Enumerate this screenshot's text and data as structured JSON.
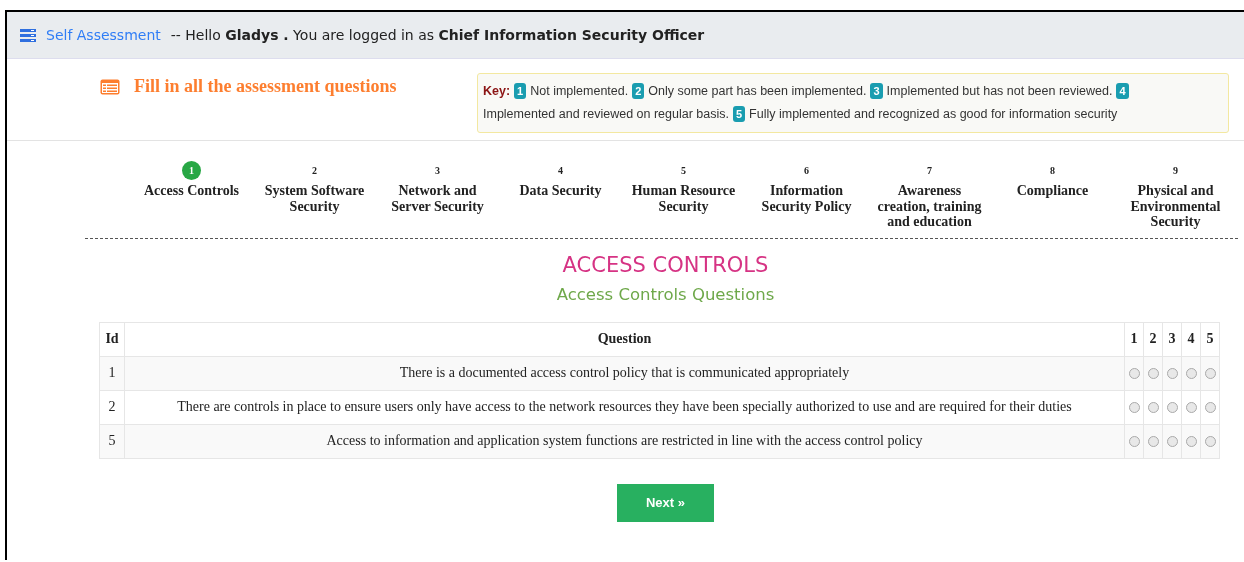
{
  "header": {
    "link": "Self Assessment",
    "greeting": "-- Hello **Gladys .** You are logged in as **Chief Information Security Officer**"
  },
  "intro": {
    "title": "Fill in all the assessment questions"
  },
  "key": {
    "label": "Key:",
    "items": [
      {
        "number": "1",
        "text": "Not implemented."
      },
      {
        "number": "2",
        "text": "Only some part has been implemented."
      },
      {
        "number": "3",
        "text": "Implemented but has not been reviewed."
      },
      {
        "number": "4",
        "text": "Implemented and reviewed on regular basis."
      },
      {
        "number": "5",
        "text": "Fully implemented and recognized as good for information security"
      }
    ]
  },
  "steps": [
    {
      "number": "1",
      "label": "Access Controls",
      "selected": true
    },
    {
      "number": "2",
      "label": "System Software Security",
      "selected": false
    },
    {
      "number": "3",
      "label": "Network and Server Security",
      "selected": false
    },
    {
      "number": "4",
      "label": "Data Security",
      "selected": false
    },
    {
      "number": "5",
      "label": "Human Resource Security",
      "selected": false
    },
    {
      "number": "6",
      "label": "Information Security Policy",
      "selected": false
    },
    {
      "number": "7",
      "label": "Awareness creation, training and education",
      "selected": false
    },
    {
      "number": "8",
      "label": "Compliance",
      "selected": false
    },
    {
      "number": "9",
      "label": "Physical and Environmental Security",
      "selected": false
    }
  ],
  "section": {
    "title": "ACCESS CONTROLS",
    "subtitle": "Access Controls Questions"
  },
  "table": {
    "columns": [
      "Id",
      "Question",
      "1",
      "2",
      "3",
      "4",
      "5"
    ],
    "rows": [
      {
        "id": "1",
        "question": "There is a documented access control policy that is communicated appropriately",
        "ratings": [
          {
            "selected": false
          },
          {
            "selected": false
          },
          {
            "selected": false
          },
          {
            "selected": false
          },
          {
            "selected": false
          }
        ]
      },
      {
        "id": "2",
        "question": "There are controls in place to ensure users only have access to the network resources they have been specially authorized to use and are required for their duties",
        "ratings": [
          {
            "selected": false
          },
          {
            "selected": false
          },
          {
            "selected": false
          },
          {
            "selected": false
          },
          {
            "selected": false
          }
        ]
      },
      {
        "id": "5",
        "question": "Access to information and application system functions are restricted in line with the access control policy",
        "ratings": [
          {
            "selected": false
          },
          {
            "selected": false
          },
          {
            "selected": false
          },
          {
            "selected": false
          },
          {
            "selected": false
          }
        ]
      }
    ]
  },
  "next_button": {
    "label": "Next",
    "icon": "»"
  }
}
